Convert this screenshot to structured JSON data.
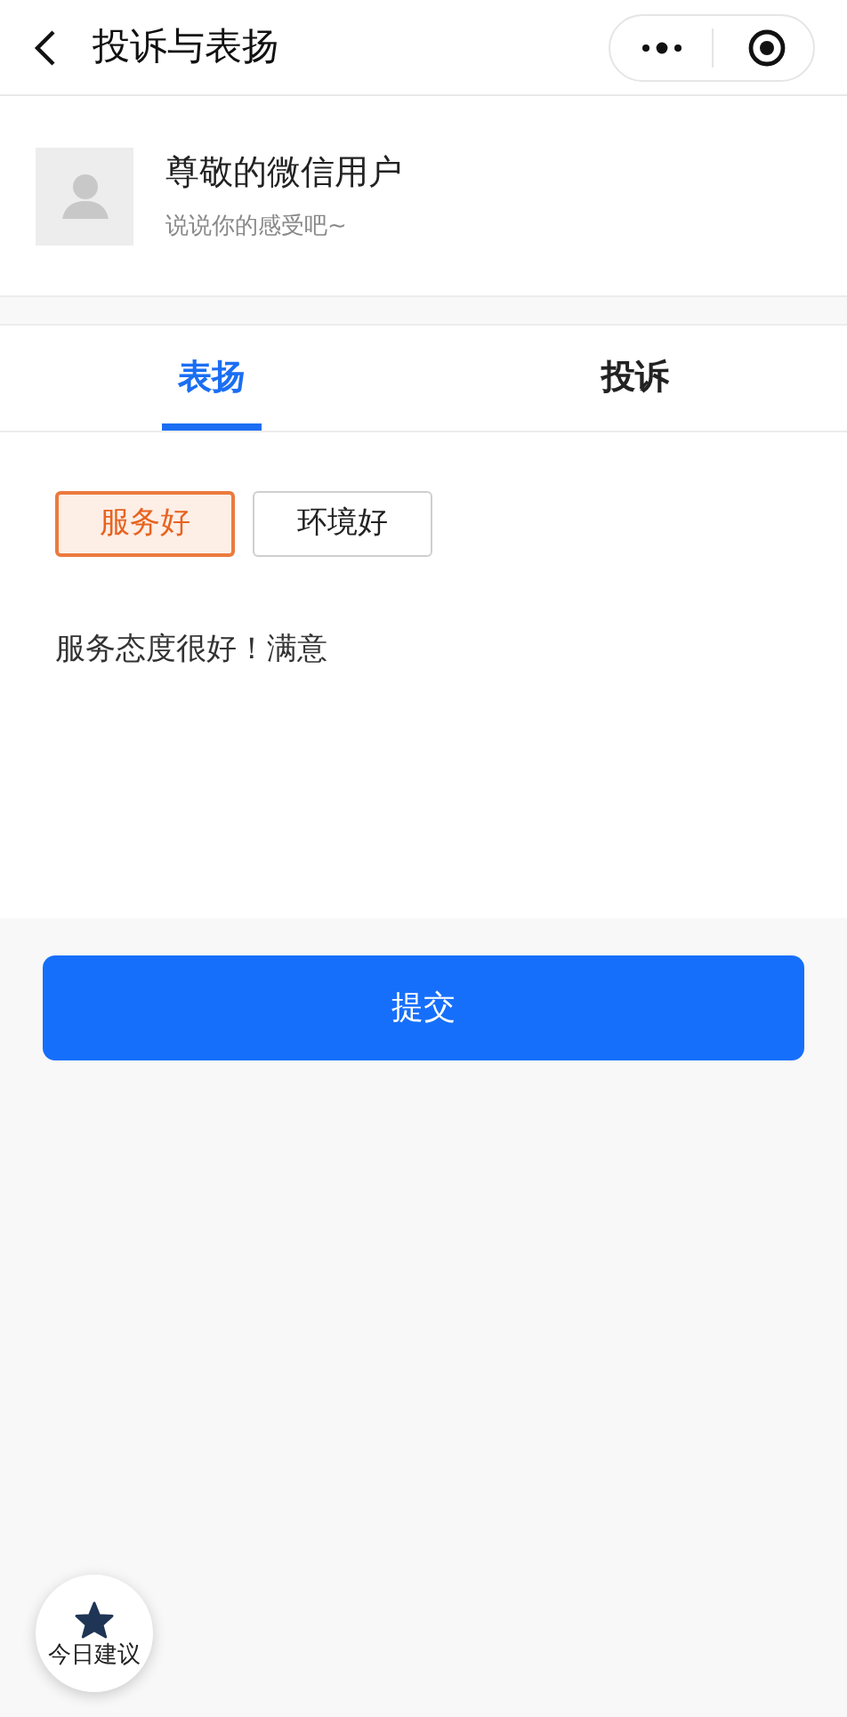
{
  "nav": {
    "title": "投诉与表扬"
  },
  "profile": {
    "name": "尊敬的微信用户",
    "subtitle": "说说你的感受吧~"
  },
  "tabs": [
    {
      "label": "表扬",
      "selected": true
    },
    {
      "label": "投诉",
      "selected": false
    }
  ],
  "tags": [
    {
      "label": "服务好",
      "selected": true
    },
    {
      "label": "环境好",
      "selected": false
    }
  ],
  "feedback": {
    "value": "服务态度很好！满意"
  },
  "submit": "提交",
  "fab": {
    "label": "今日建议"
  }
}
